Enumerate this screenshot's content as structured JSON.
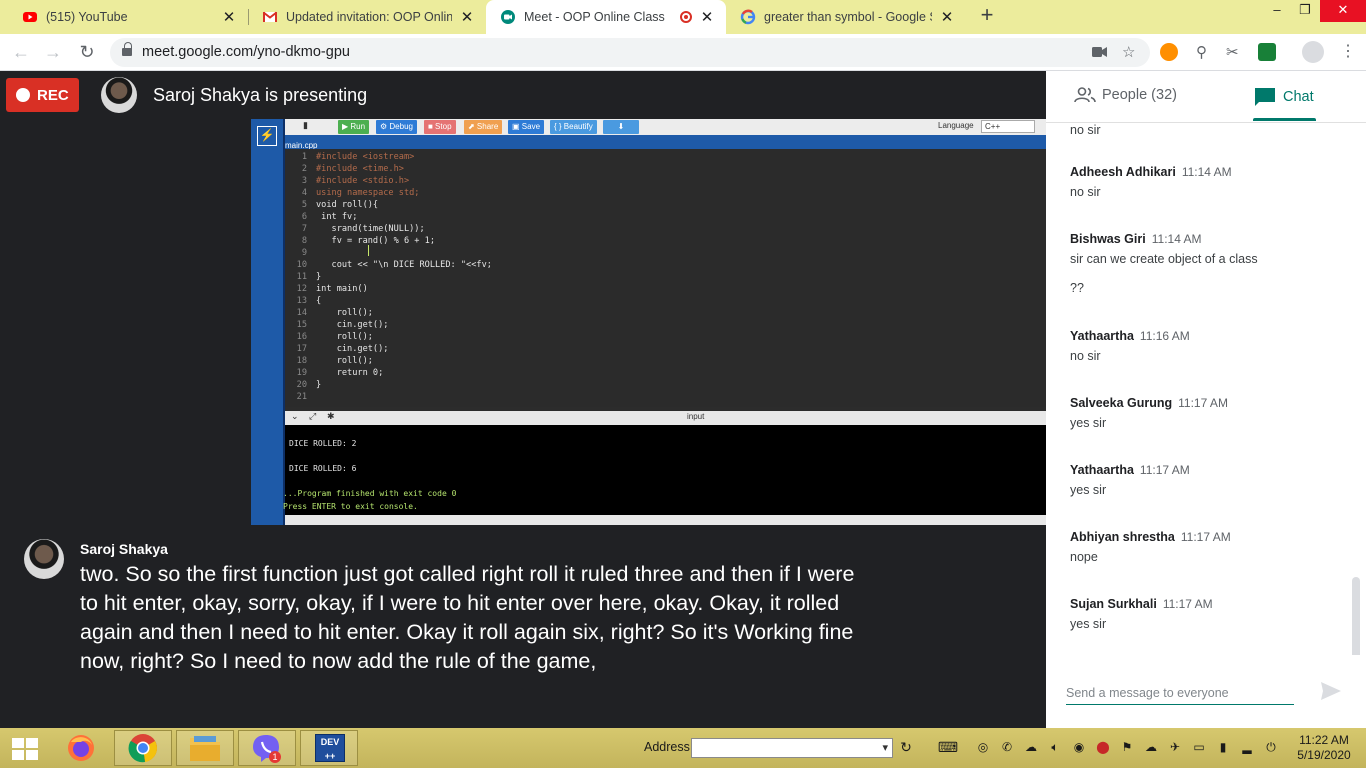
{
  "browser": {
    "tabs": [
      {
        "title": "(515) YouTube",
        "favicon": "youtube-icon",
        "active": false
      },
      {
        "title": "Updated invitation: OOP Online C",
        "favicon": "gmail-icon",
        "active": false
      },
      {
        "title": "Meet - OOP Online Class",
        "favicon": "meet-icon",
        "active": true
      },
      {
        "title": "greater than symbol - Google Se",
        "favicon": "google-icon",
        "active": false
      }
    ],
    "new_tab": "+",
    "url": "meet.google.com/yno-dkmo-gpu",
    "window_controls": {
      "minimize": "–",
      "maximize": "❐",
      "close": "✕"
    }
  },
  "meet": {
    "rec_label": "REC",
    "presenting_text": "Saroj Shakya is presenting",
    "caption": {
      "speaker": "Saroj Shakya",
      "text": "two. So so the first function just got called right roll it ruled three and then if I were to hit enter, okay, sorry, okay, if I were to hit enter over here, okay. Okay, it rolled again and then I need to hit enter. Okay it roll again six, right? So it's Working fine now, right? So I need to now add the rule of the game,"
    }
  },
  "shared_screen": {
    "ide_buttons": [
      {
        "label": "▶ Run",
        "color": "#4caf50"
      },
      {
        "label": "⚙ Debug",
        "color": "#2e7bd6"
      },
      {
        "label": "■ Stop",
        "color": "#e57373"
      },
      {
        "label": "⬈ Share",
        "color": "#f0a050"
      },
      {
        "label": "▣ Save",
        "color": "#2e7bd6"
      },
      {
        "label": "{ } Beautify",
        "color": "#4a9ae0"
      },
      {
        "label": "⬇",
        "color": "#4a9ae0"
      }
    ],
    "language_label": "Language",
    "language_value": "C++",
    "file_tab": "main.cpp",
    "code_lines": [
      {
        "n": "1",
        "t": "#include <iostream>"
      },
      {
        "n": "2",
        "t": "#include <time.h>"
      },
      {
        "n": "3",
        "t": "#include <stdio.h>"
      },
      {
        "n": "4",
        "t": "using namespace std;"
      },
      {
        "n": "5",
        "t": "void roll(){"
      },
      {
        "n": "6",
        "t": " int fv;"
      },
      {
        "n": "7",
        "t": "   srand(time(NULL));"
      },
      {
        "n": "8",
        "t": "   fv = rand() % 6 + 1;"
      },
      {
        "n": "9",
        "t": ""
      },
      {
        "n": "10",
        "t": "   cout << \"\\n DICE ROLLED: \"<<fv;"
      },
      {
        "n": "11",
        "t": "}"
      },
      {
        "n": "12",
        "t": "int main()"
      },
      {
        "n": "13",
        "t": "{"
      },
      {
        "n": "14",
        "t": "    roll();"
      },
      {
        "n": "15",
        "t": "    cin.get();"
      },
      {
        "n": "16",
        "t": "    roll();"
      },
      {
        "n": "17",
        "t": "    cin.get();"
      },
      {
        "n": "18",
        "t": "    roll();"
      },
      {
        "n": "19",
        "t": "    return 0;"
      },
      {
        "n": "20",
        "t": "}"
      },
      {
        "n": "21",
        "t": ""
      }
    ],
    "console_header": "input",
    "console_lines": [
      "DICE ROLLED: 2",
      "DICE ROLLED: 6",
      "...Program finished with exit code 0",
      "Press ENTER to exit console."
    ]
  },
  "panel": {
    "people_tab": "People (32)",
    "chat_tab": "Chat",
    "partial_top": "no sir",
    "messages": [
      {
        "name": "Adheesh Adhikari",
        "time": "11:14 AM",
        "text": "no sir"
      },
      {
        "name": "Bishwas Giri",
        "time": "11:14 AM",
        "text": "sir can we  create object of a class",
        "extra": "??"
      },
      {
        "name": "Yathaartha",
        "time": "11:16 AM",
        "text": "no sir"
      },
      {
        "name": "Salveeka Gurung",
        "time": "11:17 AM",
        "text": "yes sir"
      },
      {
        "name": "Yathaartha",
        "time": "11:17 AM",
        "text": "yes sir"
      },
      {
        "name": "Abhiyan shrestha",
        "time": "11:17 AM",
        "text": "nope"
      },
      {
        "name": "Sujan Surkhali",
        "time": "11:17 AM",
        "text": "yes sir"
      }
    ],
    "compose_placeholder": "Send a message to everyone"
  },
  "taskbar": {
    "address_label": "Address",
    "clock_time": "11:22 AM",
    "clock_date": "5/19/2020",
    "viber_badge": "1",
    "devcpp_label": "DEV"
  }
}
